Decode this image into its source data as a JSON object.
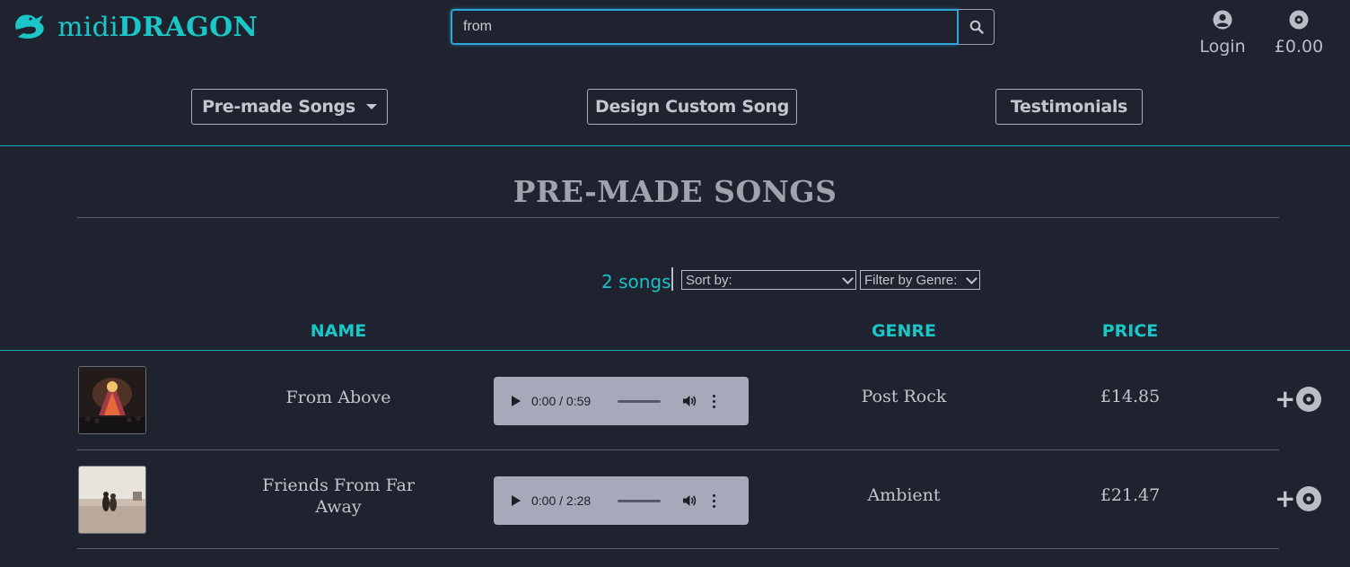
{
  "header": {
    "logo_part1": "midi",
    "logo_part2": "DRAGON",
    "search_value": "from",
    "login_label": "Login",
    "cart_label": "£0.00"
  },
  "nav": {
    "premade_label": "Pre-made Songs",
    "custom_label": "Design Custom Song",
    "testimonials_label": "Testimonials"
  },
  "main": {
    "title": "PRE-MADE SONGS",
    "count": "2 songs",
    "sort_label": "Sort by:",
    "filter_label": "Filter by Genre:"
  },
  "table": {
    "headers": {
      "name": "NAME",
      "genre": "GENRE",
      "price": "PRICE"
    },
    "rows": [
      {
        "name": "From Above",
        "time": "0:00 / 0:59",
        "progress": 0.0,
        "genre": "Post Rock",
        "price": "£14.85"
      },
      {
        "name": "Friends From Far Away",
        "time": "0:00 / 2:28",
        "progress": 0.0,
        "genre": "Ambient",
        "price": "£21.47"
      }
    ]
  },
  "colors": {
    "background": "#1f2330",
    "accent": "#1bc6c6",
    "focus": "#2fa6d8",
    "audio_bg": "#a6a9b9"
  }
}
